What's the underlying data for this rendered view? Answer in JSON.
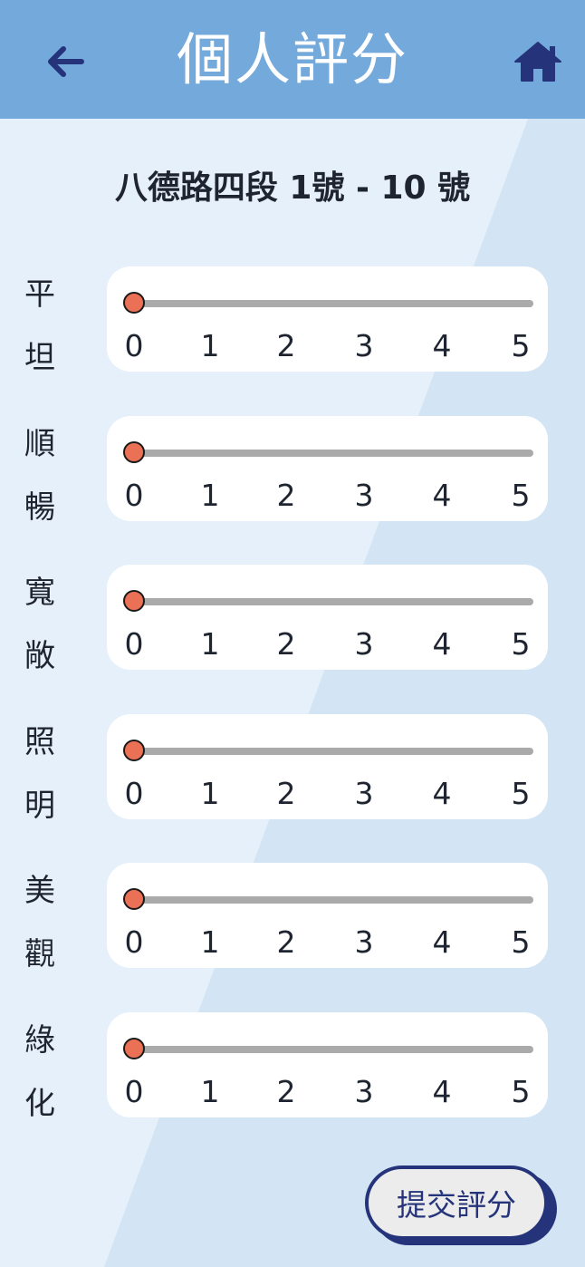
{
  "header": {
    "title": "個人評分",
    "back_icon": "arrow-left-icon",
    "home_icon": "home-icon"
  },
  "location": "八德路四段 1號 - 10 號",
  "scale_ticks": [
    "0",
    "1",
    "2",
    "3",
    "4",
    "5"
  ],
  "criteria": [
    {
      "label_top": "平",
      "label_bottom": "坦",
      "value": 0
    },
    {
      "label_top": "順",
      "label_bottom": "暢",
      "value": 0
    },
    {
      "label_top": "寬",
      "label_bottom": "敞",
      "value": 0
    },
    {
      "label_top": "照",
      "label_bottom": "明",
      "value": 0
    },
    {
      "label_top": "美",
      "label_bottom": "觀",
      "value": 0
    },
    {
      "label_top": "綠",
      "label_bottom": "化",
      "value": 0
    }
  ],
  "submit_label": "提交評分",
  "colors": {
    "header_bg": "#74a9db",
    "page_bg": "#e6f0fa",
    "stripe_bg": "#d3e5f4",
    "thumb": "#ea7155",
    "track": "#aaaaaa",
    "accent": "#25347a"
  }
}
